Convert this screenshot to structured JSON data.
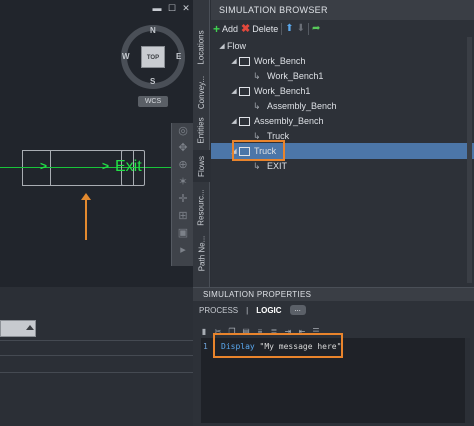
{
  "viewport": {
    "compass": {
      "north": "N",
      "south": "S",
      "east": "E",
      "west": "W"
    },
    "viewcube_top": "TOP",
    "wcs": "WCS",
    "exit_label": "Exit",
    "flow_arrows": [
      ">",
      ">"
    ],
    "window_buttons": [
      "▬",
      "☐"
    ]
  },
  "vertical_tabs": [
    "Locations",
    "Convey...",
    "Entities",
    "Flows",
    "Resourc...",
    "Path Ne..."
  ],
  "browser": {
    "title": "SIMULATION BROWSER",
    "toolbar": {
      "add": "Add",
      "delete": "Delete"
    },
    "tree": [
      {
        "label": "Flow",
        "level": 0,
        "expander": "◢",
        "icon": "none"
      },
      {
        "label": "Work_Bench",
        "level": 1,
        "expander": "◢",
        "icon": "box"
      },
      {
        "label": "Work_Bench1",
        "level": 2,
        "expander": "",
        "icon": "link"
      },
      {
        "label": "Work_Bench1",
        "level": 1,
        "expander": "◢",
        "icon": "box"
      },
      {
        "label": "Assembly_Bench",
        "level": 2,
        "expander": "",
        "icon": "link"
      },
      {
        "label": "Assembly_Bench",
        "level": 1,
        "expander": "◢",
        "icon": "box"
      },
      {
        "label": "Truck",
        "level": 2,
        "expander": "",
        "icon": "link"
      },
      {
        "label": "Truck",
        "level": 1,
        "expander": "◢",
        "icon": "box",
        "selected": true
      },
      {
        "label": "EXIT",
        "level": 2,
        "expander": "",
        "icon": "link"
      }
    ]
  },
  "properties": {
    "title": "SIMULATION PROPERTIES",
    "tabs": {
      "process": "PROCESS",
      "divider": "|",
      "logic": "LOGIC",
      "more": "..."
    },
    "editor": {
      "line_number": "1",
      "keyword": "Display",
      "argument": " \"My message here\""
    }
  },
  "colors": {
    "accent_highlight": "#e9842c",
    "selection": "#4c76a8",
    "flow_green": "#22e046"
  }
}
